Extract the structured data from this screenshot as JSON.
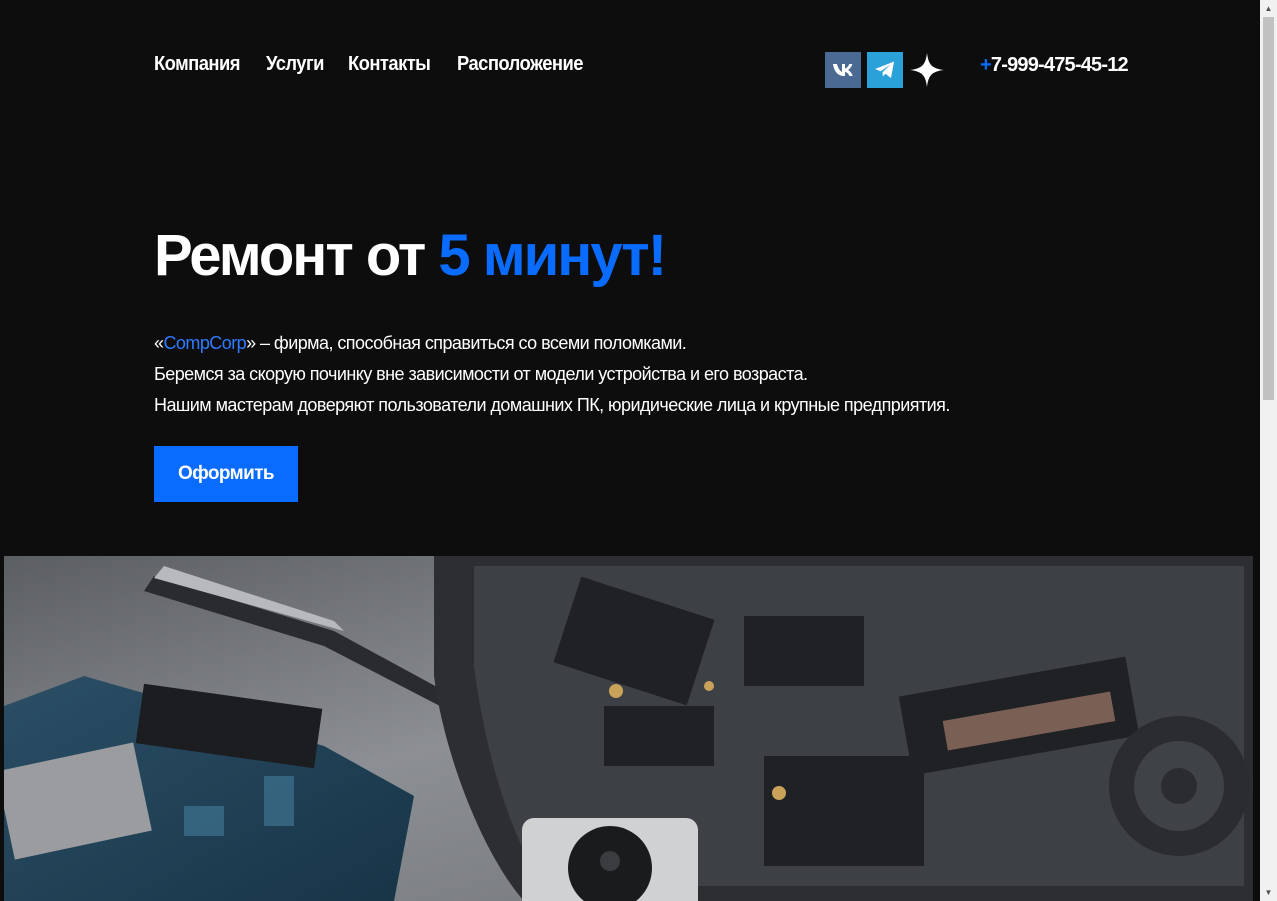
{
  "nav": {
    "items": [
      {
        "label": "Компания"
      },
      {
        "label": "Услуги"
      },
      {
        "label": "Контакты"
      },
      {
        "label": "Расположение"
      }
    ]
  },
  "socials": [
    {
      "icon": "vk-icon",
      "color": "#4a6a94"
    },
    {
      "icon": "telegram-icon",
      "color": "#2aa1d9"
    },
    {
      "icon": "star-logo-icon",
      "color": "#ffffff"
    }
  ],
  "phone": {
    "plus": "+",
    "number": "7-999-475-45-12"
  },
  "hero": {
    "title_main": "Ремонт от ",
    "title_accent": "5 минут!",
    "quote_open": "«",
    "brand": "CompCorp",
    "line1_rest": "» – фирма, способная справиться со всеми поломками.",
    "line2": "Беремся за скорую починку вне зависимости от модели устройства и его возраста.",
    "line3": "Нашим мастерам доверяют пользователи домашних ПК, юридические лица и крупные предприятия.",
    "cta_label": "Оформить"
  },
  "colors": {
    "background": "#0d0d0d",
    "accent": "#0a6cff",
    "text": "#ffffff"
  },
  "image": {
    "subject": "disassembled smartphone circuit boards and tweezers"
  }
}
